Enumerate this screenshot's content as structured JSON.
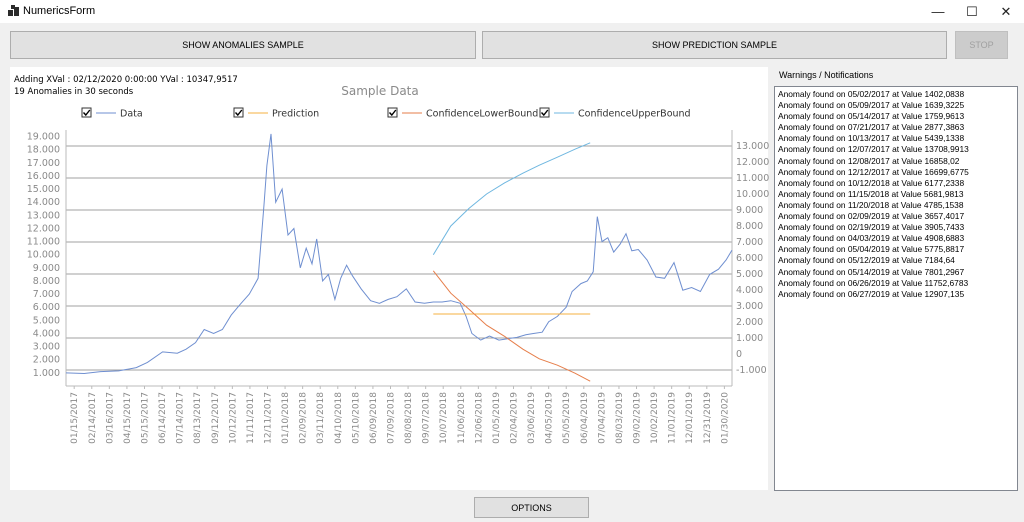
{
  "window": {
    "title": "NumericsForm",
    "minimize_glyph": "—",
    "maximize_glyph": "☐",
    "close_glyph": "✕"
  },
  "toolbar": {
    "show_anomalies_label": "SHOW ANOMALIES SAMPLE",
    "show_prediction_label": "SHOW PREDICTION SAMPLE",
    "stop_label": "STOP",
    "options_label": "OPTIONS"
  },
  "status": {
    "adding_text": "Adding XVal : 02/12/2020 0:00:00 YVal : 10347,9517",
    "anomalies_text": "19 Anomalies in 30 seconds"
  },
  "warnings": {
    "label": "Warnings / Notifications",
    "items": [
      "Anomaly found on 05/02/2017 at Value 1402,0838",
      "Anomaly found on 05/09/2017 at Value 1639,3225",
      "Anomaly found on 05/14/2017 at Value 1759,9613",
      "Anomaly found on 07/21/2017 at Value 2877,3863",
      "Anomaly found on 10/13/2017 at Value 5439,1338",
      "Anomaly found on 12/07/2017 at Value 13708,9913",
      "Anomaly found on 12/08/2017 at Value 16858,02",
      "Anomaly found on 12/12/2017 at Value 16699,6775",
      "Anomaly found on 10/12/2018 at Value 6177,2338",
      "Anomaly found on 11/15/2018 at Value 5681,9813",
      "Anomaly found on 11/20/2018 at Value 4785,1538",
      "Anomaly found on 02/09/2019 at Value 3657,4017",
      "Anomaly found on 02/19/2019 at Value 3905,7433",
      "Anomaly found on 04/03/2019 at Value 4908,6883",
      "Anomaly found on 05/04/2019 at Value 5775,8817",
      "Anomaly found on 05/12/2019 at Value 7184,64",
      "Anomaly found on 05/14/2019 at Value 7801,2967",
      "Anomaly found on 06/26/2019 at Value 11752,6783",
      "Anomaly found on 06/27/2019 at Value 12907,135"
    ]
  },
  "chart_data": {
    "type": "line",
    "title": "Sample Data",
    "legend_placement": "top",
    "grid": true,
    "y_left": {
      "ticks": [
        "1.000",
        "2.000",
        "3.000",
        "4.000",
        "5.000",
        "6.000",
        "7.000",
        "8.000",
        "9.000",
        "10.000",
        "11.000",
        "12.000",
        "13.000",
        "14.000",
        "15.000",
        "16.000",
        "17.000",
        "18.000",
        "19.000"
      ],
      "range": [
        0,
        19500
      ]
    },
    "y_right": {
      "ticks": [
        "-1.000",
        "0",
        "1.000",
        "2.000",
        "3.000",
        "4.000",
        "5.000",
        "6.000",
        "7.000",
        "8.000",
        "9.000",
        "10.000",
        "11.000",
        "12.000",
        "13.000"
      ],
      "range": [
        -2000,
        14000
      ]
    },
    "x_ticks": [
      "01/15/2017",
      "02/14/2017",
      "03/16/2017",
      "04/15/2017",
      "05/15/2017",
      "06/14/2017",
      "07/14/2017",
      "08/13/2017",
      "09/12/2017",
      "10/12/2017",
      "11/11/2017",
      "12/11/2017",
      "01/10/2018",
      "02/09/2018",
      "03/11/2018",
      "04/10/2018",
      "05/10/2018",
      "06/09/2018",
      "07/09/2018",
      "08/08/2018",
      "09/07/2018",
      "10/07/2018",
      "11/06/2018",
      "12/06/2018",
      "01/05/2019",
      "02/04/2019",
      "03/06/2019",
      "04/05/2019",
      "05/05/2019",
      "06/04/2019",
      "07/04/2019",
      "08/03/2019",
      "09/02/2019",
      "10/02/2019",
      "11/01/2019",
      "12/01/2019",
      "12/31/2019",
      "01/30/2020"
    ],
    "series": [
      {
        "name": "Data",
        "axis": "left",
        "color": "#6f8fd0",
        "x": [
          "01/01/2017",
          "02/01/2017",
          "03/01/2017",
          "04/01/2017",
          "05/01/2017",
          "05/20/2017",
          "06/15/2017",
          "07/10/2017",
          "07/25/2017",
          "08/10/2017",
          "08/25/2017",
          "09/10/2017",
          "09/25/2017",
          "10/10/2017",
          "10/25/2017",
          "11/10/2017",
          "11/25/2017",
          "12/05/2017",
          "12/10/2017",
          "12/17/2017",
          "12/25/2017",
          "01/05/2018",
          "01/15/2018",
          "01/25/2018",
          "02/05/2018",
          "02/15/2018",
          "02/25/2018",
          "03/05/2018",
          "03/15/2018",
          "03/25/2018",
          "04/05/2018",
          "04/15/2018",
          "04/25/2018",
          "05/05/2018",
          "05/20/2018",
          "06/05/2018",
          "06/20/2018",
          "07/05/2018",
          "07/20/2018",
          "08/05/2018",
          "08/20/2018",
          "09/05/2018",
          "09/20/2018",
          "10/05/2018",
          "10/20/2018",
          "11/05/2018",
          "11/15/2018",
          "11/25/2018",
          "12/10/2018",
          "12/25/2018",
          "01/10/2019",
          "01/25/2019",
          "02/10/2019",
          "02/25/2019",
          "03/10/2019",
          "03/25/2019",
          "04/05/2019",
          "04/20/2019",
          "05/05/2019",
          "05/15/2019",
          "05/30/2019",
          "06/10/2019",
          "06/20/2019",
          "06/27/2019",
          "07/05/2019",
          "07/15/2019",
          "07/25/2019",
          "08/05/2019",
          "08/15/2019",
          "08/25/2019",
          "09/05/2019",
          "09/20/2019",
          "10/05/2019",
          "10/20/2019",
          "11/05/2019",
          "11/20/2019",
          "12/05/2019",
          "12/20/2019",
          "01/05/2020",
          "01/20/2020",
          "02/02/2020",
          "02/12/2020"
        ],
        "y": [
          1000,
          950,
          1100,
          1150,
          1400,
          1800,
          2600,
          2500,
          2800,
          3300,
          4300,
          4000,
          4300,
          5400,
          6200,
          7000,
          8200,
          13800,
          16800,
          19200,
          14000,
          15000,
          11500,
          12000,
          9000,
          10500,
          9300,
          11200,
          8000,
          8500,
          6600,
          8200,
          9200,
          8400,
          7400,
          6500,
          6300,
          6600,
          6800,
          7400,
          6400,
          6300,
          6400,
          6400,
          6500,
          6300,
          5300,
          4000,
          3500,
          3800,
          3500,
          3600,
          3700,
          3900,
          4000,
          4100,
          4900,
          5300,
          6000,
          7200,
          7800,
          8000,
          8700,
          12900,
          11000,
          11300,
          10200,
          10800,
          11600,
          10300,
          10400,
          9600,
          8300,
          8200,
          9400,
          7300,
          7500,
          7200,
          8500,
          8900,
          9600,
          10348
        ]
      },
      {
        "name": "Prediction",
        "axis": "right",
        "color": "#f5b041",
        "x": [
          "09/20/2018",
          "06/15/2019"
        ],
        "y": [
          2500,
          2500
        ]
      },
      {
        "name": "ConfidenceLowerBound",
        "axis": "right",
        "color": "#e67e4a",
        "x": [
          "09/20/2018",
          "10/20/2018",
          "11/20/2018",
          "12/20/2018",
          "01/20/2019",
          "02/20/2019",
          "03/20/2019",
          "04/20/2019",
          "05/20/2019",
          "06/15/2019"
        ],
        "y": [
          5200,
          3800,
          2800,
          1800,
          1100,
          300,
          -300,
          -700,
          -1200,
          -1700
        ]
      },
      {
        "name": "ConfidenceUpperBound",
        "axis": "right",
        "color": "#6fb7e0",
        "x": [
          "09/20/2018",
          "10/20/2018",
          "11/20/2018",
          "12/20/2018",
          "01/20/2019",
          "02/20/2019",
          "03/20/2019",
          "04/20/2019",
          "05/20/2019",
          "06/15/2019"
        ],
        "y": [
          6200,
          8000,
          9100,
          10000,
          10700,
          11300,
          11800,
          12300,
          12800,
          13200
        ]
      }
    ]
  }
}
